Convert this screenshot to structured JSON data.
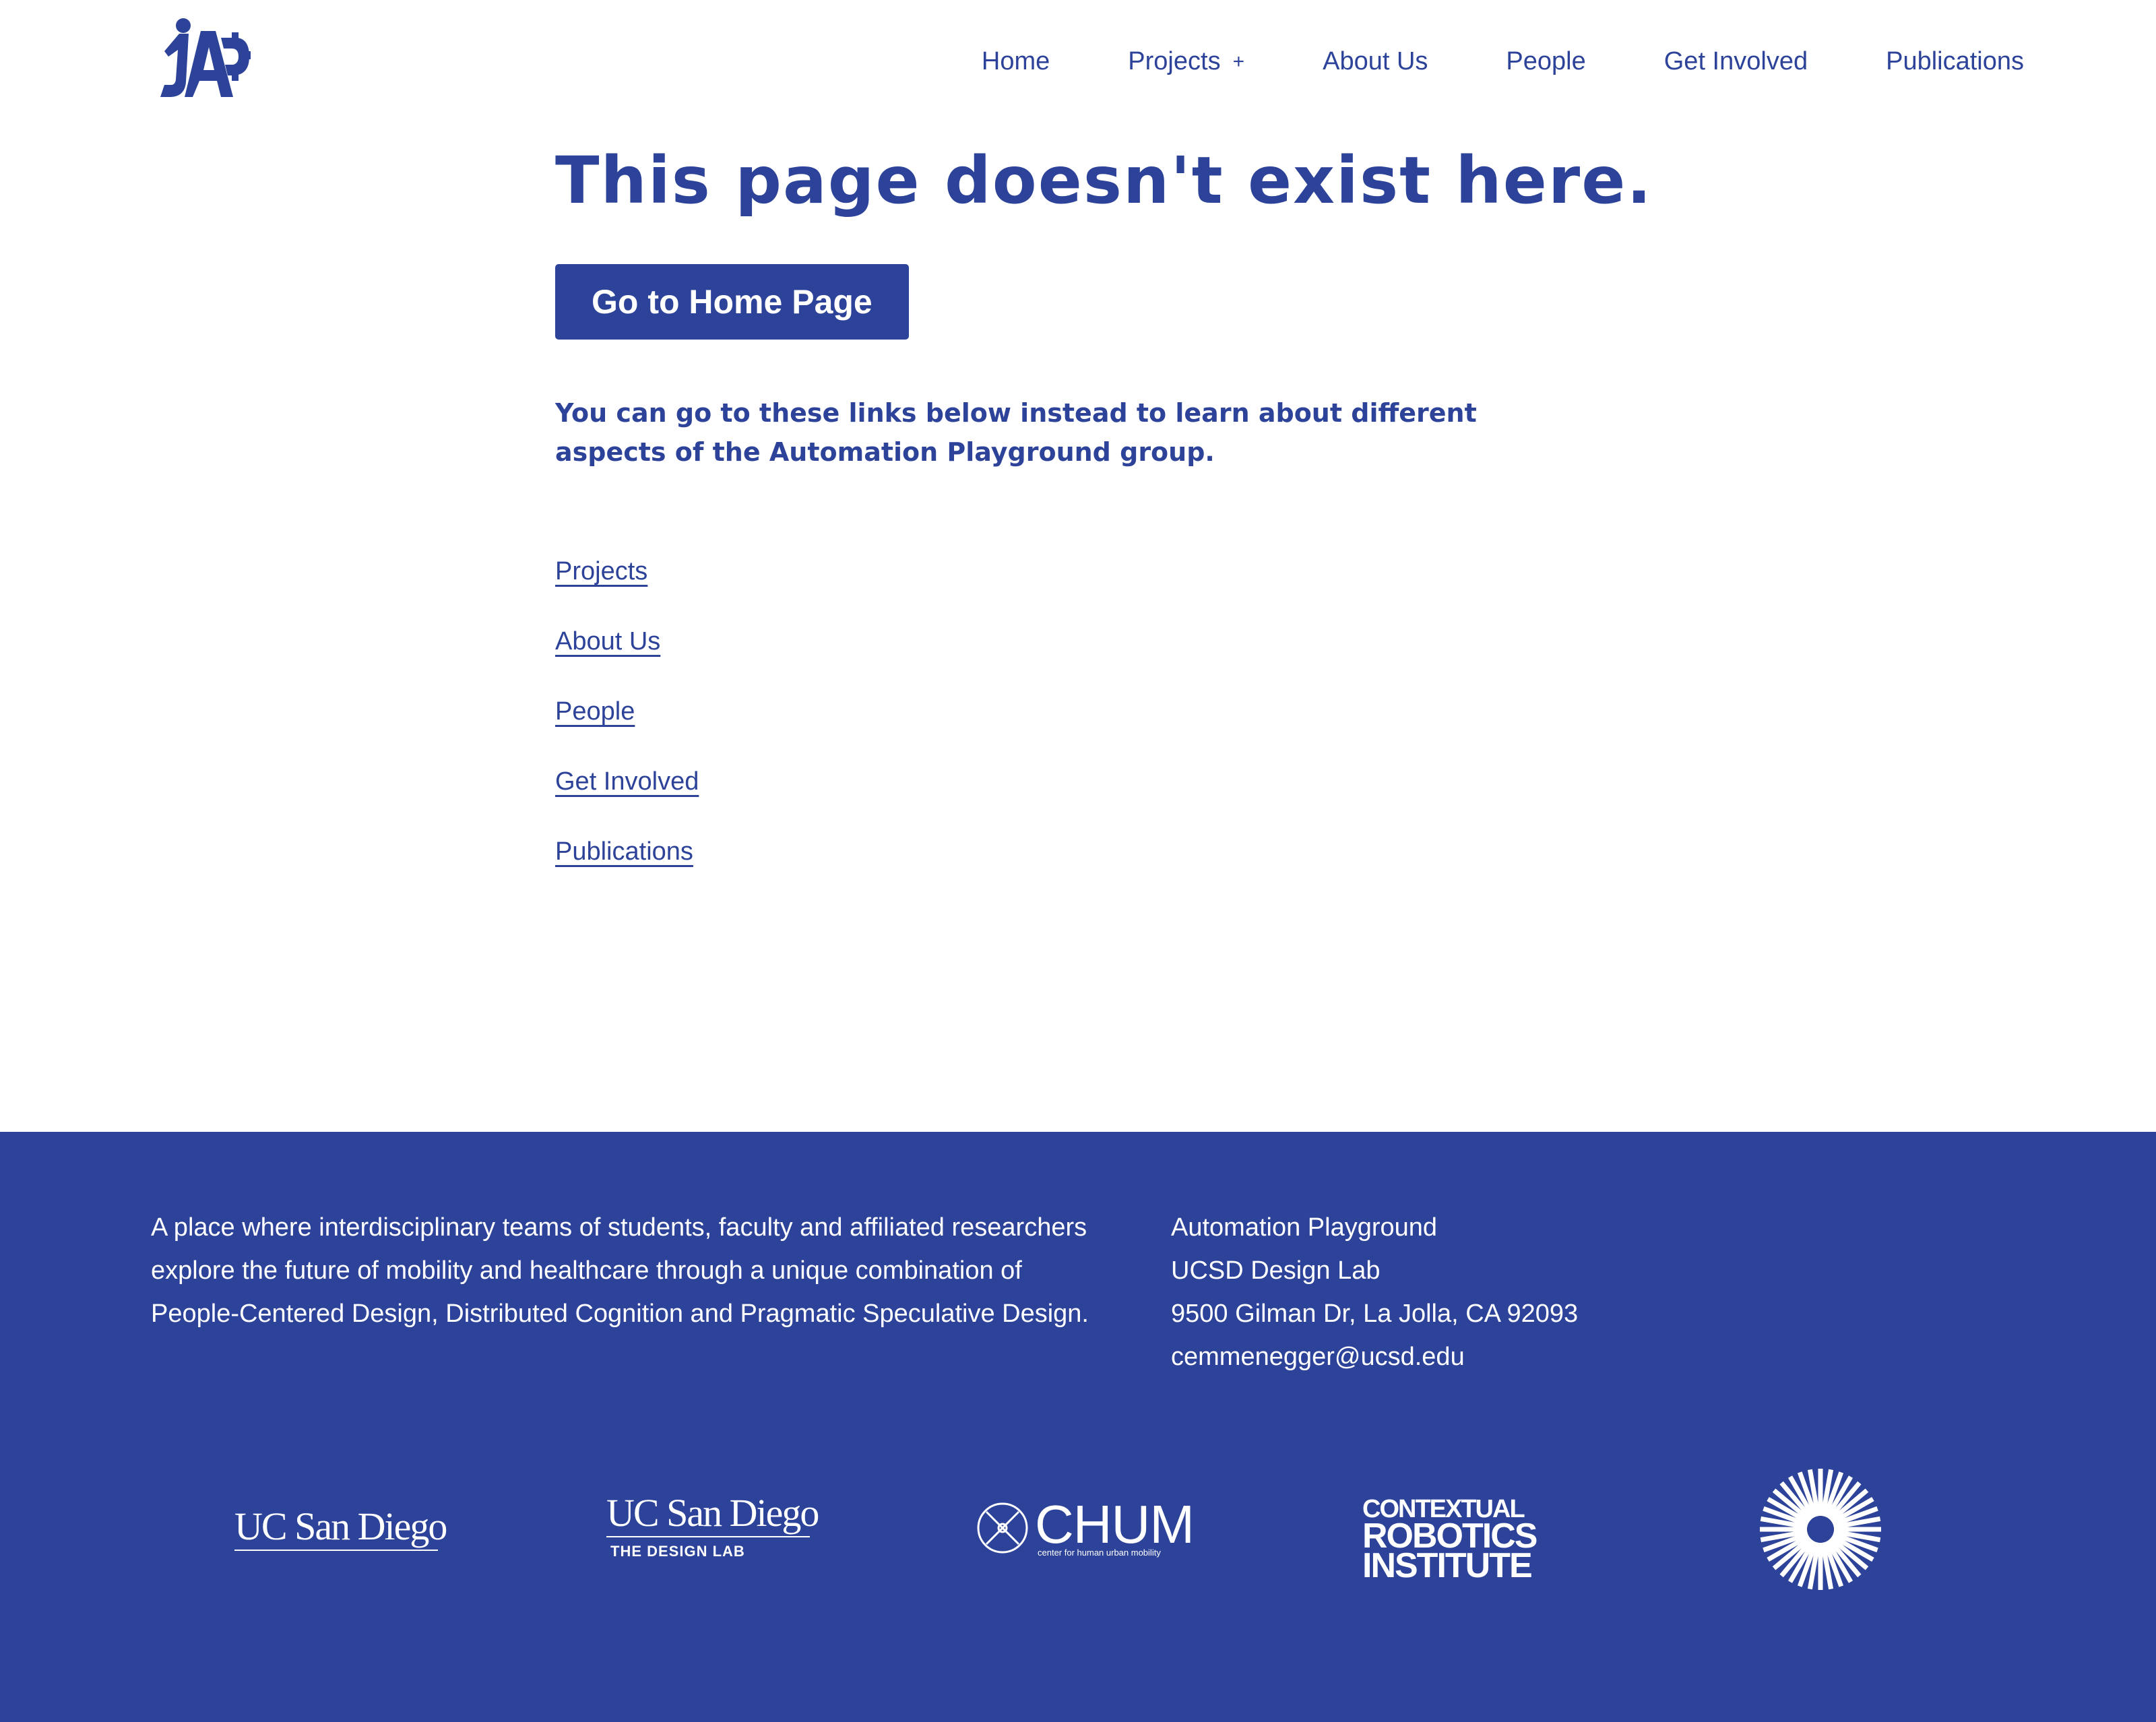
{
  "header": {
    "logo_text": "AP",
    "nav": [
      {
        "label": "Home"
      },
      {
        "label": "Projects",
        "expand": "+"
      },
      {
        "label": "About Us"
      },
      {
        "label": "People"
      },
      {
        "label": "Get Involved"
      },
      {
        "label": "Publications"
      }
    ]
  },
  "main": {
    "title": "This page doesn't exist here.",
    "home_button": "Go to Home Page",
    "intro": "You can go to these links below instead to learn about different aspects of the Automation Playground group.",
    "links": [
      "Projects",
      "About Us",
      "People",
      "Get Involved",
      "Publications"
    ]
  },
  "footer": {
    "description": "A place where interdisciplinary teams of students, faculty and affiliated researchers explore the future of mobility and healthcare through a unique combination of People-Centered Design, Distributed Cognition and Pragmatic Speculative Design.",
    "contact": [
      "Automation Playground",
      "UCSD Design Lab",
      "9500 Gilman Dr, La Jolla, CA 92093",
      "cemmenegger@ucsd.edu"
    ],
    "partners": {
      "ucsd": "UC San Diego",
      "designlab_name": "UC San Diego",
      "designlab_sub": "THE DESIGN LAB",
      "chum_name": "CHUM",
      "chum_sub": "center for human urban mobility",
      "cri_lines": [
        "CONTEXTUAL",
        "ROBOTICS",
        "INSTITUTE"
      ]
    }
  },
  "colors": {
    "brand": "#2d4399",
    "background": "#ffffff",
    "footer_text": "#ffffff"
  }
}
